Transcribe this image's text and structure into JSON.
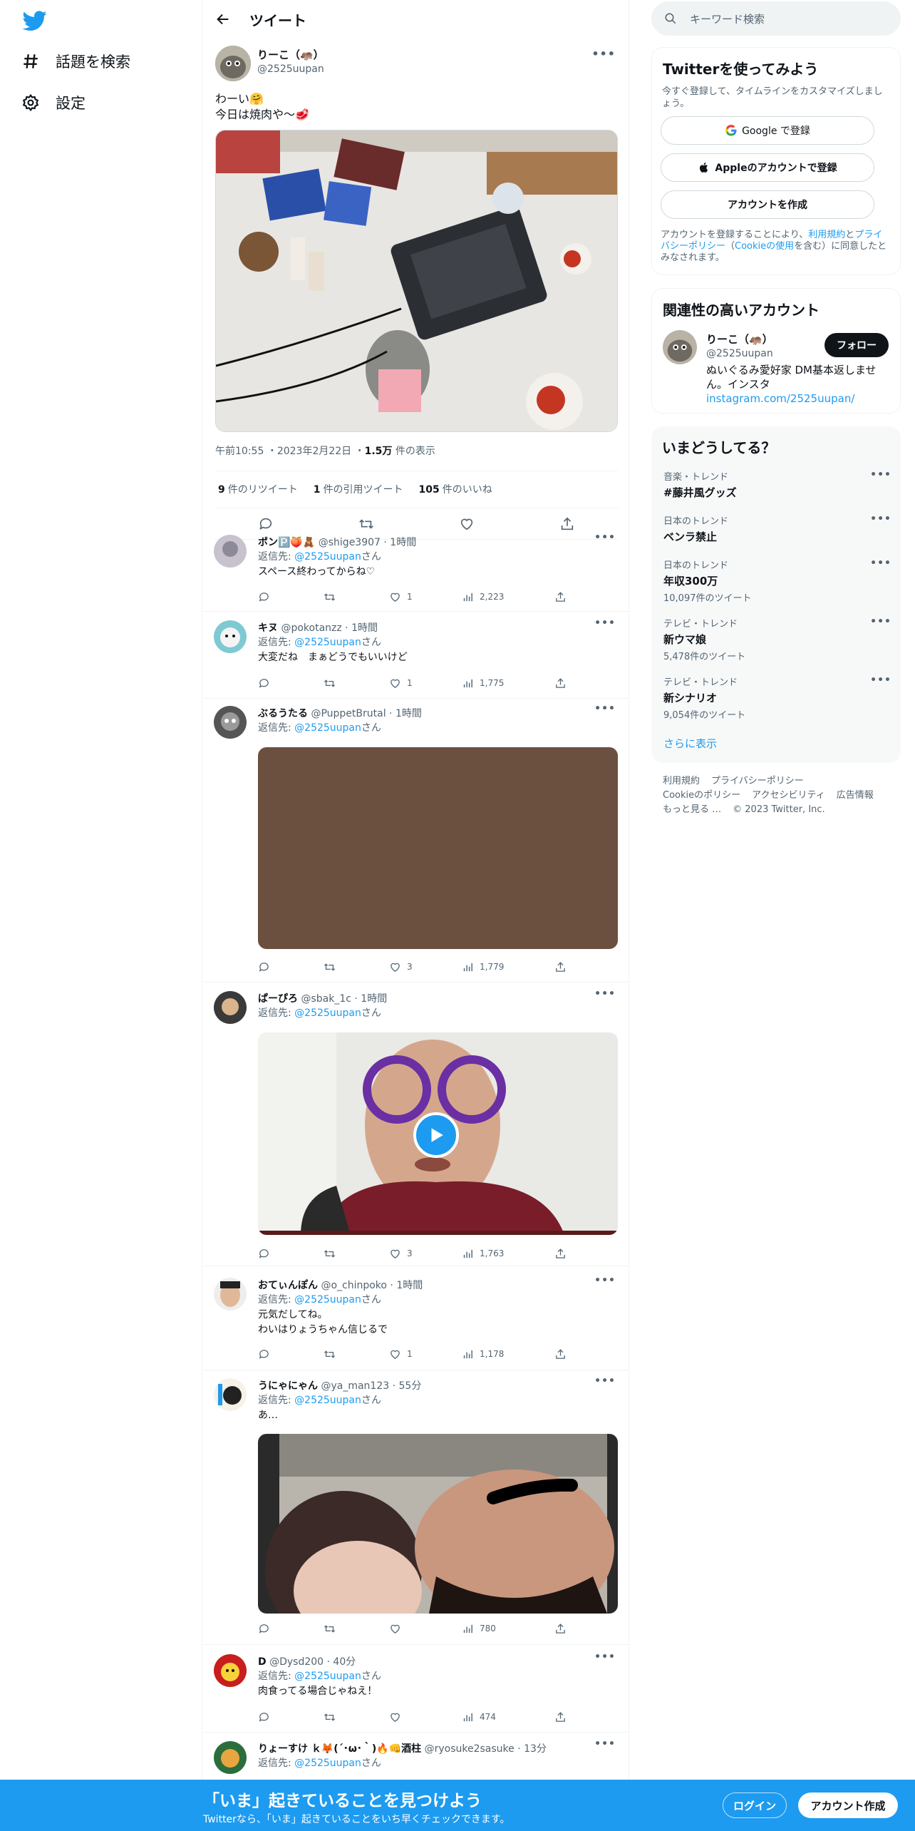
{
  "nav": {
    "explore_label": "話題を検索",
    "settings_label": "設定"
  },
  "header": {
    "title": "ツイート"
  },
  "tweet": {
    "author_name": "りーこ（🦛）",
    "author_handle": "@2525uupan",
    "text_line1": "わーい🤗",
    "text_line2": "今日は焼肉や〜🥩",
    "time": "午前10:55",
    "date": "2023年2月22日",
    "views_count": "1.5万",
    "views_label": "件の表示",
    "retweets_count": "9",
    "retweets_label": "件のリツイート",
    "quotes_count": "1",
    "quotes_label": "件の引用ツイート",
    "likes_count": "105",
    "likes_label": "件のいいね"
  },
  "reply_prefix": "返信先: ",
  "reply_suffix": "さん",
  "replies": [
    {
      "name": "ポン🅿️🍑🧸",
      "handle": "@shige3907",
      "time": "1時間",
      "to": "@2525uupan",
      "text": "スペース終わってからね♡",
      "likes": "1",
      "views": "2,223"
    },
    {
      "name": "キヌ",
      "handle": "@pokotanzz",
      "time": "1時間",
      "to": "@2525uupan",
      "text": "大変だね　まぁどうでもいいけど",
      "likes": "1",
      "views": "1,775"
    },
    {
      "name": "ぶるうたる",
      "handle": "@PuppetBrutal",
      "time": "1時間",
      "to": "@2525uupan",
      "text": "",
      "likes": "3",
      "views": "1,779"
    },
    {
      "name": "ぱーぴろ",
      "handle": "@sbak_1c",
      "time": "1時間",
      "to": "@2525uupan",
      "text": "",
      "likes": "3",
      "views": "1,763"
    },
    {
      "name": "おてぃんぽん",
      "handle": "@o_chinpoko",
      "time": "1時間",
      "to": "@2525uupan",
      "text": "元気だしてね。",
      "text2": "わいはりょうちゃん信じるで",
      "likes": "1",
      "views": "1,178"
    },
    {
      "name": "うにゃにゃん",
      "handle": "@ya_man123",
      "time": "55分",
      "to": "@2525uupan",
      "text": "あ…",
      "likes": "",
      "views": "780"
    },
    {
      "name": "D",
      "handle": "@Dysd200",
      "time": "40分",
      "to": "@2525uupan",
      "text": "肉食ってる場合じゃねえ！",
      "likes": "",
      "views": "474"
    },
    {
      "name": "りょーすけ ｋ🦊(´･ω･｀)🔥👊酒柱",
      "handle": "@ryosuke2sasuke",
      "time": "13分",
      "to": "@2525uupan",
      "text": "",
      "likes": "",
      "views": ""
    }
  ],
  "right": {
    "search_placeholder": "キーワード検索",
    "signup_card": {
      "title": "Twitterを使ってみよう",
      "subtitle": "今すぐ登録して、タイムラインをカスタマイズしましょう。",
      "google_label": "Google で登録",
      "apple_label": "Appleのアカウントで登録",
      "create_label": "アカウントを作成",
      "legal_1": "アカウントを登録することにより、",
      "legal_terms": "利用規約",
      "legal_2": "と",
      "legal_privacy": "プライバシーポリシー",
      "legal_3": "（",
      "legal_cookie": "Cookieの使用",
      "legal_4": "を含む）に同意したとみなされます。"
    },
    "related": {
      "title": "関連性の高いアカウント",
      "name": "りーこ（🦛）",
      "handle": "@2525uupan",
      "follow_label": "フォロー",
      "bio": "ぬいぐるみ愛好家 DM基本返しません。インス",
      "bio2_prefix": "タ",
      "bio_link": "instagram.com/2525uupan/"
    },
    "trends": {
      "title": "いまどうしてる？",
      "items": [
        {
          "category": "音楽・トレンド",
          "name": "#藤井風グッズ",
          "count": ""
        },
        {
          "category": "日本のトレンド",
          "name": "ベンラ禁止",
          "count": ""
        },
        {
          "category": "日本のトレンド",
          "name": "年収300万",
          "count": "10,097件のツイート"
        },
        {
          "category": "テレビ・トレンド",
          "name": "新ウマ娘",
          "count": "5,478件のツイート"
        },
        {
          "category": "テレビ・トレンド",
          "name": "新シナリオ",
          "count": "9,054件のツイート"
        }
      ],
      "more_label": "さらに表示"
    },
    "footer": {
      "terms": "利用規約",
      "privacy": "プライバシーポリシー",
      "cookie": "Cookieのポリシー",
      "accessibility": "アクセシビリティ",
      "ads": "広告情報",
      "more": "もっと見る …",
      "copyright": "© 2023 Twitter, Inc."
    }
  },
  "bottom_bar": {
    "headline": "「いま」起きていることを見つけよう",
    "subline": "Twitterなら、「いま」起きていることをいち早くチェックできます。",
    "login_label": "ログイン",
    "signup_label": "アカウント作成"
  },
  "colors": {
    "accent": "#1d9bf0",
    "text": "#0f1419",
    "secondary": "#536471"
  }
}
